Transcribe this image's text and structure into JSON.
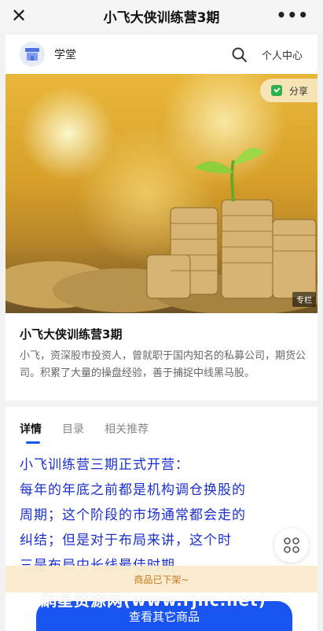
{
  "topbar": {
    "title": "小飞大侠训练营3期",
    "close_icon": "close-icon",
    "more_icon": "more-icon"
  },
  "header": {
    "shop_name": "学堂",
    "user_center": "个人中心",
    "search_icon": "search-icon"
  },
  "hero": {
    "share_label": "分享",
    "column_tag": "专栏"
  },
  "course": {
    "title": "小飞大侠训练营3期",
    "description": "小飞，资深股市投资人，曾就职于国内知名的私募公司，期货公司。积累了大量的操盘经验，善于捕捉中线黑马股。"
  },
  "tabs": [
    {
      "label": "详情",
      "active": true
    },
    {
      "label": "目录",
      "active": false
    },
    {
      "label": "相关推荐",
      "active": false
    }
  ],
  "article": {
    "lines": [
      "小飞训练营三期正式开营：",
      "每年的年底之前都是机构调仓换股的",
      "周期；这个阶段的市场通常都会走的",
      "纠结；但是对于布局来讲，这个时",
      "三是布局中长线最佳时期"
    ]
  },
  "offshelf_notice": "商品已下架~",
  "watermark": "網星资源网(www.rjnc.net)",
  "cta_label": "查看其它商品",
  "colors": {
    "accent": "#1a55f2",
    "article_text": "#1a2fd0",
    "notice_text": "#c9781d"
  }
}
